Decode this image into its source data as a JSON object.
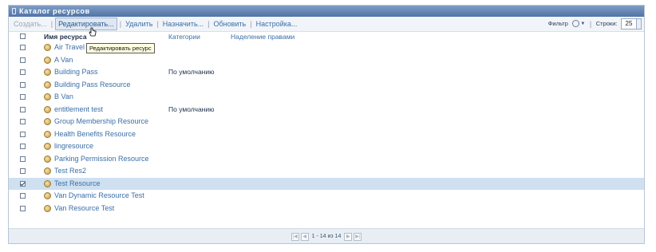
{
  "window": {
    "title": "Каталог ресурсов"
  },
  "toolbar": {
    "create_label": "Создать...",
    "edit_label": "Редактировать...",
    "delete_label": "Удалить",
    "assign_label": "Назначить...",
    "refresh_label": "Обновить",
    "settings_label": "Настройка...",
    "filter_label": "Фильтр",
    "rows_label": "Строки:",
    "rows_value": "25"
  },
  "table": {
    "columns": [
      "Имя ресурса",
      "Категории",
      "Наделение правами"
    ],
    "rows": [
      {
        "name": "Air Travel Resource",
        "category": "",
        "checked": false
      },
      {
        "name": "A Van",
        "category": "",
        "checked": false
      },
      {
        "name": "Building Pass",
        "category": "По умолчанию",
        "checked": false
      },
      {
        "name": "Building Pass Resource",
        "category": "",
        "checked": false
      },
      {
        "name": "B Van",
        "category": "",
        "checked": false
      },
      {
        "name": "entitlement test",
        "category": "По умолчанию",
        "checked": false
      },
      {
        "name": "Group Membership Resource",
        "category": "",
        "checked": false
      },
      {
        "name": "Health Benefits Resource",
        "category": "",
        "checked": false
      },
      {
        "name": "lingresource",
        "category": "",
        "checked": false
      },
      {
        "name": "Parking Permission Resource",
        "category": "",
        "checked": false
      },
      {
        "name": "Test Res2",
        "category": "",
        "checked": false
      },
      {
        "name": "Test Resource",
        "category": "",
        "checked": true
      },
      {
        "name": "Van Dynamic Resource Test",
        "category": "",
        "checked": false
      },
      {
        "name": "Van Resource Test",
        "category": "",
        "checked": false
      }
    ]
  },
  "pager": {
    "range_text": "1 - 14 из 14"
  },
  "tooltip": {
    "text": "Редактировать ресурс"
  },
  "colors": {
    "title_bar": "#5f81b3",
    "link": "#3a6fa8",
    "selected_row": "#cfe0f1"
  }
}
